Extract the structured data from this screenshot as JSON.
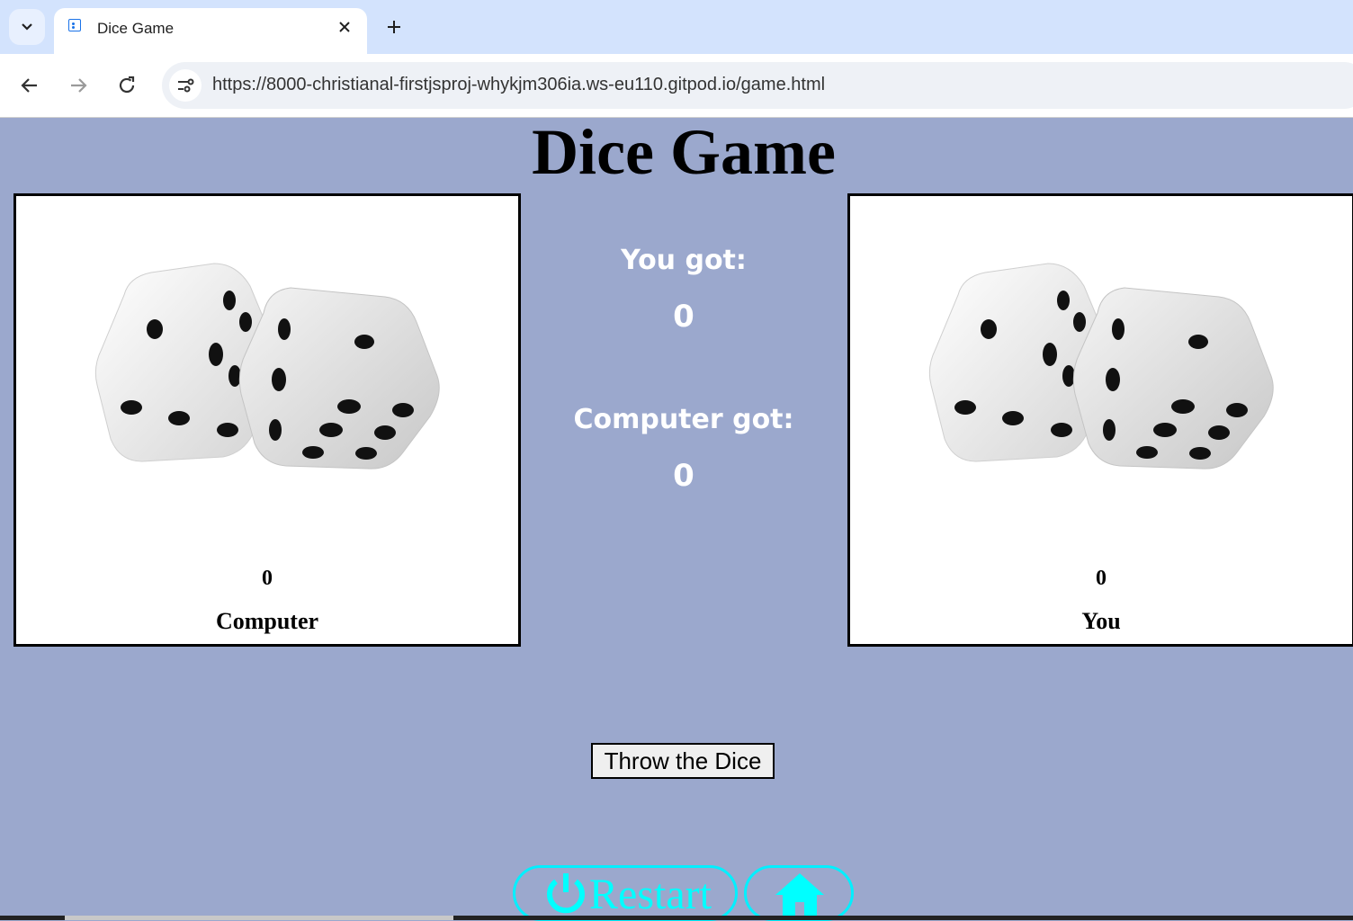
{
  "browser": {
    "tab_title": "Dice Game",
    "url": "https://8000-christianal-firstjsproj-whykjm306ia.ws-eu110.gitpod.io/game.html"
  },
  "page": {
    "title": "Dice Game",
    "computer_panel": {
      "score": "0",
      "name": "Computer"
    },
    "you_panel": {
      "score": "0",
      "name": "You"
    },
    "you_got_label": "You got:",
    "you_got_value": "0",
    "computer_got_label": "Computer got:",
    "computer_got_value": "0",
    "throw_button": "Throw the Dice",
    "restart_button": "Restart"
  },
  "icons": {
    "tab_dropdown": "chevron-down-icon",
    "tab_favicon": "dice-favicon-icon",
    "tab_close": "close-icon",
    "new_tab": "plus-icon",
    "back": "arrow-left-icon",
    "forward": "arrow-right-icon",
    "reload": "reload-icon",
    "site_info": "tune-icon",
    "restart": "power-icon",
    "home": "home-icon"
  },
  "colors": {
    "page_background": "#9ba8cd",
    "button_accent": "#00ffff",
    "tab_strip": "#d3e3fd"
  }
}
